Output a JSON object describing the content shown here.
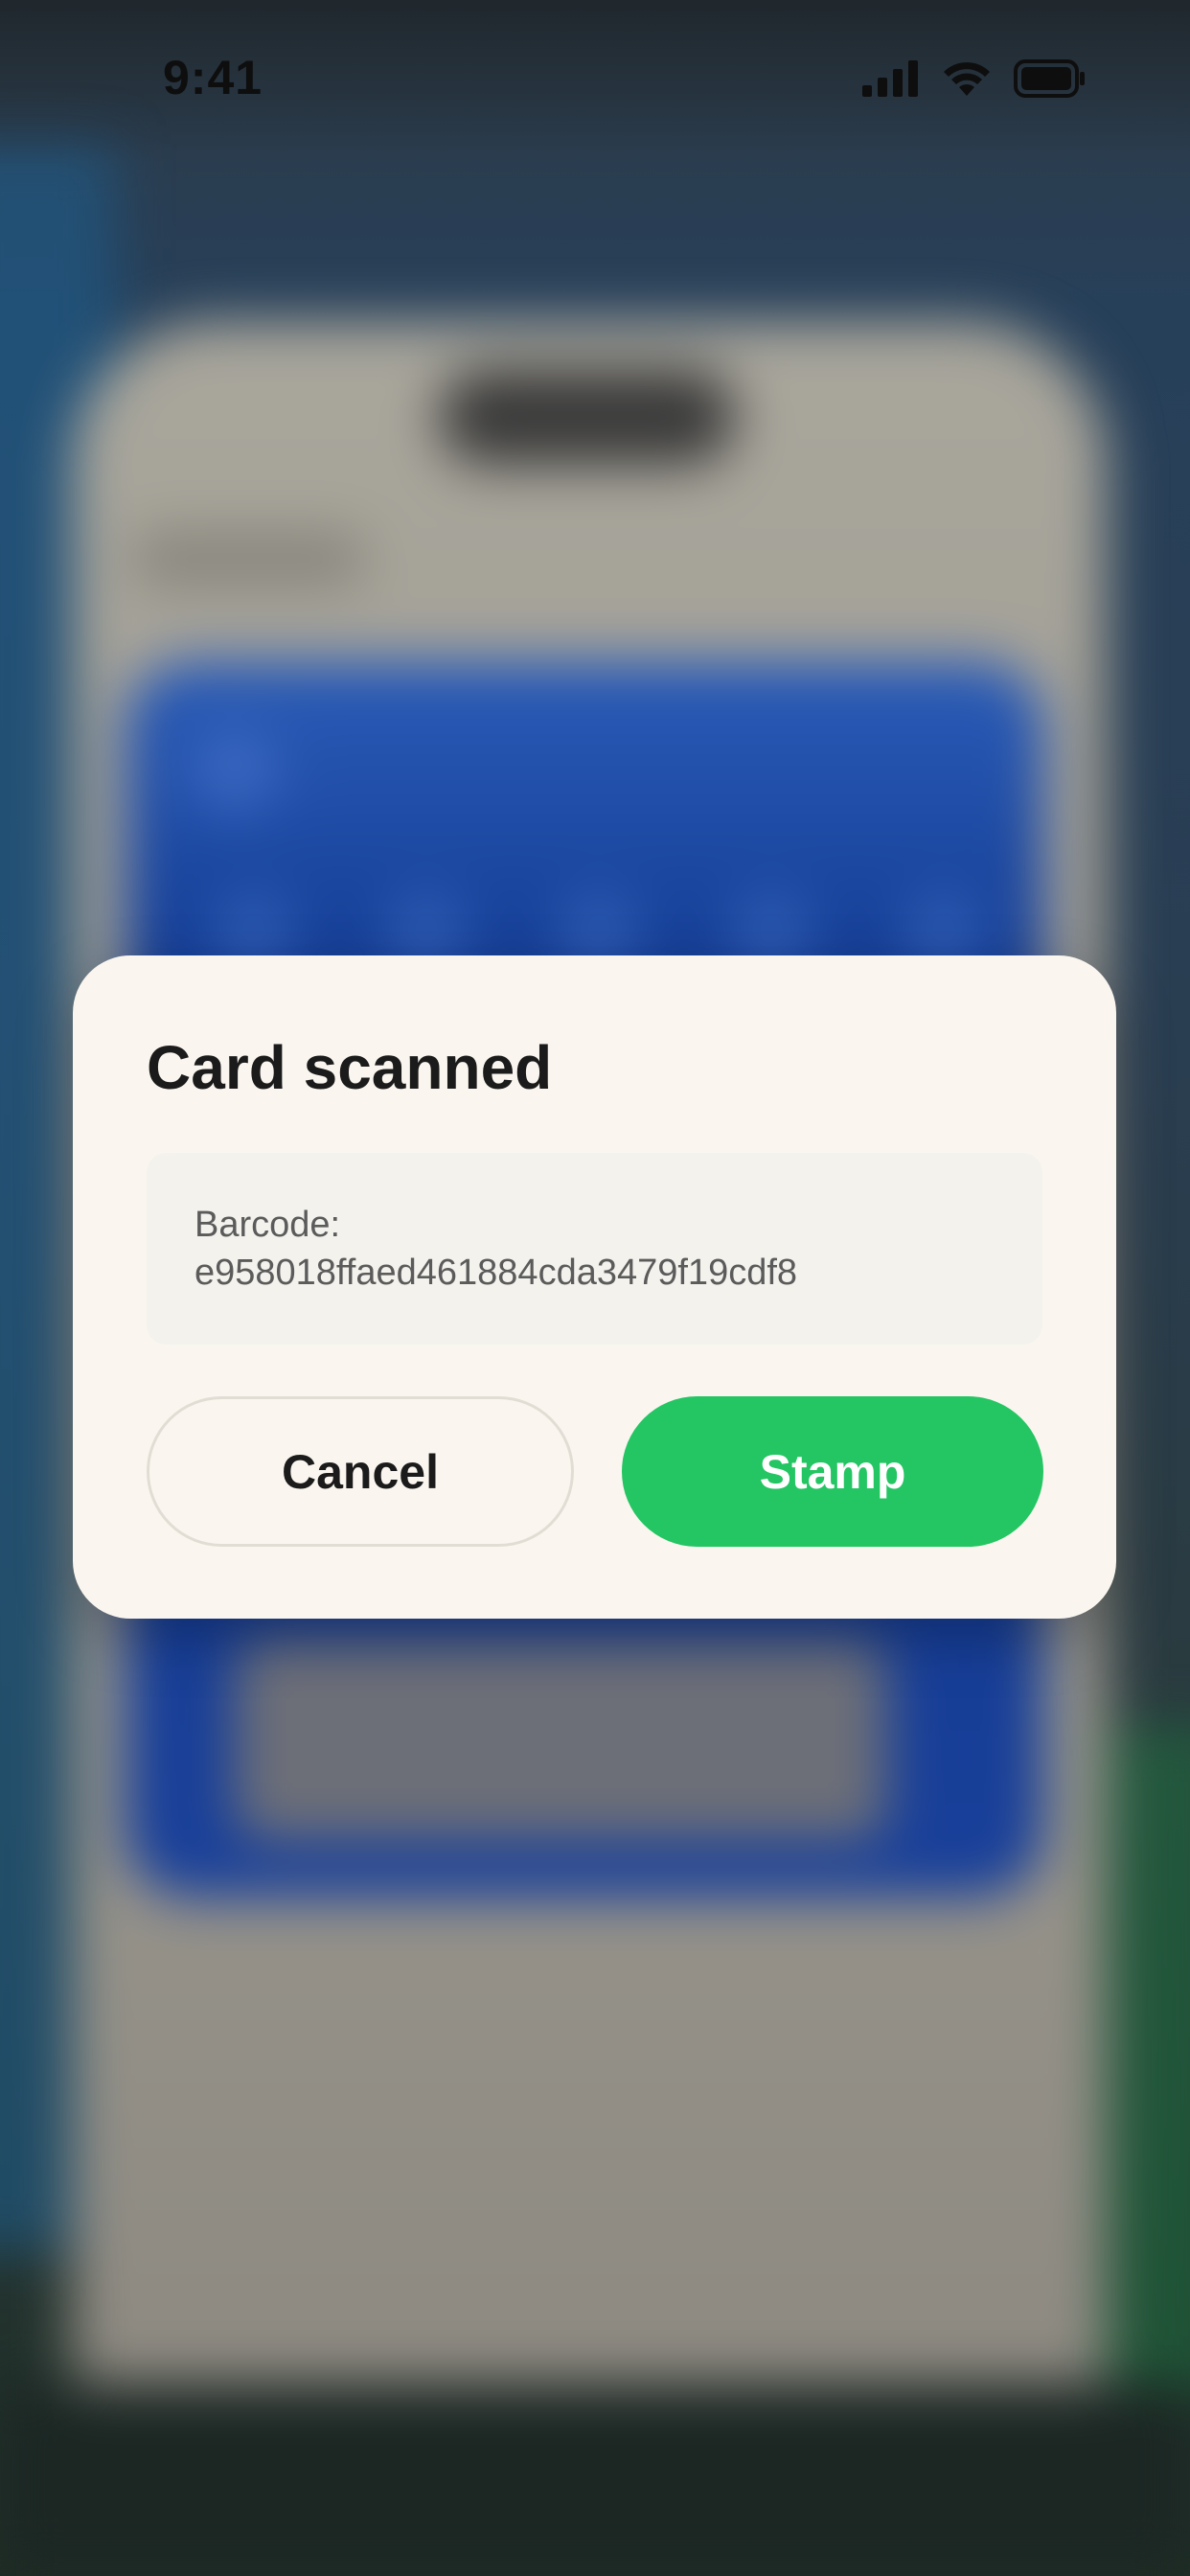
{
  "status_bar": {
    "time": "9:41",
    "icons": [
      "cellular-signal-icon",
      "wifi-icon",
      "battery-icon"
    ]
  },
  "dialog": {
    "title": "Card scanned",
    "barcode_label": "Barcode:",
    "barcode_value": "e958018ffaed461884cda3479f19cdf8",
    "cancel_label": "Cancel",
    "stamp_label": "Stamp"
  },
  "colors": {
    "accent_green": "#24c563",
    "dialog_background": "#faf6ef",
    "barcode_box_background": "#f3f2ed",
    "background_card_blue": "#10378e"
  }
}
